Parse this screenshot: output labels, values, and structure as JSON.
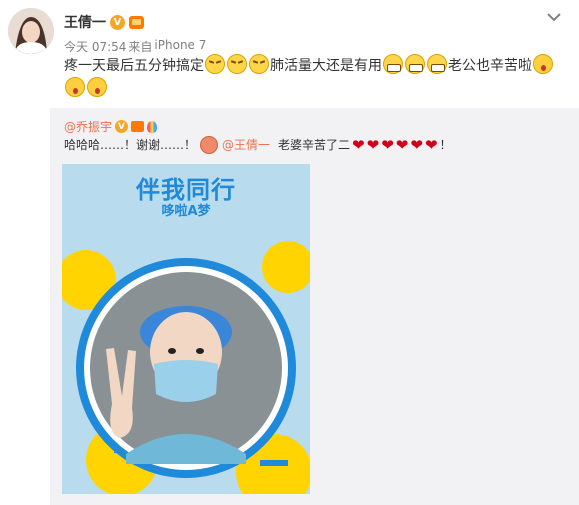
{
  "post": {
    "author": "王倩一",
    "time": "今天 07:54",
    "source_prefix": "来自",
    "source": "iPhone 7",
    "text_parts": [
      "疼一天最后五分钟搞定",
      "肺活量大还是有用",
      "老公也辛苦啦"
    ]
  },
  "repost": {
    "author": "@乔振宇",
    "text_1": "哈哈哈……！谢谢……！",
    "mention": "@王倩一",
    "text_2": "老婆辛苦了二",
    "text_end": "！"
  },
  "photo": {
    "title": "伴我同行",
    "subtitle": "哆啦A梦"
  },
  "colors": {
    "accent": "#eb7350",
    "repost_bg": "#f2f2f5",
    "verified": "#f5a623",
    "heart": "#d0021b",
    "poster_blue": "#1e8ad9",
    "poster_yellow": "#ffd400"
  },
  "icons": [
    "verified-icon",
    "member-crown-icon",
    "chevron-down-icon",
    "tired-emoji",
    "grin-emoji",
    "shocked-emoji",
    "heart-emoji",
    "balloon-icon"
  ]
}
